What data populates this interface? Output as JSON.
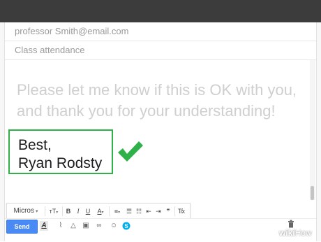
{
  "compose": {
    "to": "professor Smith@email.com",
    "subject": "Class attendance",
    "body": "Please let me know if this is OK with you,\nand thank you for your understanding!",
    "signature": "Best,\nRyan Rodsty"
  },
  "format_toolbar": {
    "font": "Micros",
    "size_label": "тT",
    "bold_label": "B",
    "italic_label": "I",
    "underline_label": "U",
    "text_color_label": "A",
    "quote_label": "❞",
    "clear_format_label": "T̸x"
  },
  "bottom_bar": {
    "send_label": "Send",
    "format_icon_label": "A"
  },
  "watermark": {
    "brand_bold": "wiki",
    "brand_light": "How"
  },
  "colors": {
    "highlight_green": "#2fb14a",
    "send_blue": "#4a8af4",
    "top_bar": "#3c3c3c",
    "placeholder_text": "#cfcfcf"
  }
}
